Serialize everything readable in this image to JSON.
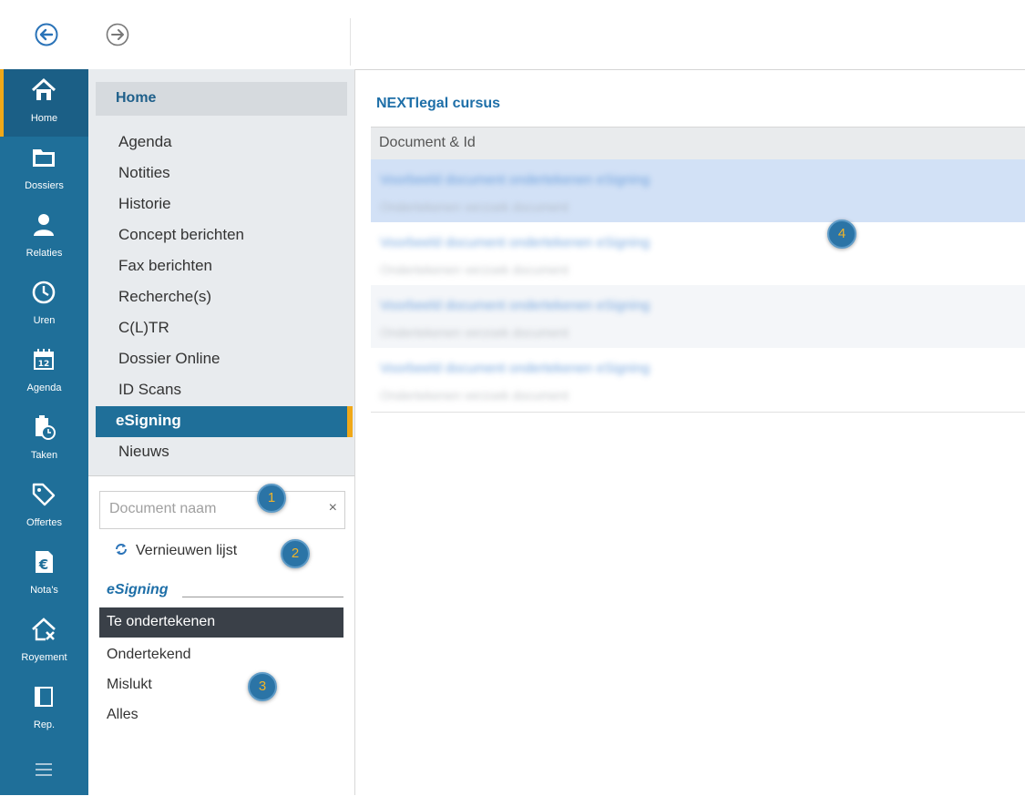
{
  "toolbar": {
    "back_icon": "arrow-left-circle-icon",
    "forward_icon": "arrow-right-circle-icon"
  },
  "rail": {
    "items": [
      {
        "label": "Home",
        "icon": "home-icon",
        "active": true
      },
      {
        "label": "Dossiers",
        "icon": "folder-icon"
      },
      {
        "label": "Relaties",
        "icon": "person-icon"
      },
      {
        "label": "Uren",
        "icon": "clock-icon"
      },
      {
        "label": "Agenda",
        "icon": "calendar-icon"
      },
      {
        "label": "Taken",
        "icon": "clipboard-clock-icon"
      },
      {
        "label": "Offertes",
        "icon": "tag-icon"
      },
      {
        "label": "Nota's",
        "icon": "invoice-euro-icon"
      },
      {
        "label": "Royement",
        "icon": "house-x-icon"
      },
      {
        "label": "Rep.",
        "icon": "book-icon"
      }
    ],
    "menu_icon": "hamburger-icon"
  },
  "nav": {
    "home": "Home",
    "items": [
      "Agenda",
      "Notities",
      "Historie",
      "Concept berichten",
      "Fax berichten",
      "Recherche(s)",
      "C(L)TR",
      "Dossier Online",
      "ID Scans",
      "eSigning",
      "Nieuws"
    ],
    "selected": "eSigning"
  },
  "search": {
    "placeholder": "Document naam",
    "clear": "×"
  },
  "refresh_label": "Vernieuwen lijst",
  "section_title": "eSigning",
  "filters": [
    "Te ondertekenen",
    "Ondertekend",
    "Mislukt",
    "Alles"
  ],
  "filter_selected": "Te ondertekenen",
  "main": {
    "title": "NEXTlegal cursus",
    "column_header": "Document & Id",
    "rows": [
      {
        "line1": "Voorbeeld document ondertekenen eSigning",
        "line2": "Ondertekenen verzoek document"
      },
      {
        "line1": "Voorbeeld document ondertekenen eSigning",
        "line2": "Ondertekenen verzoek document"
      },
      {
        "line1": "Voorbeeld document ondertekenen eSigning",
        "line2": "Ondertekenen verzoek document"
      },
      {
        "line1": "Voorbeeld document ondertekenen eSigning",
        "line2": "Ondertekenen verzoek document"
      }
    ]
  },
  "badges": [
    "1",
    "2",
    "3",
    "4"
  ],
  "colors": {
    "rail": "#1f6f99",
    "accent": "#f0a818",
    "link": "#1e6fa8",
    "selected_row": "#d2e1f6"
  }
}
